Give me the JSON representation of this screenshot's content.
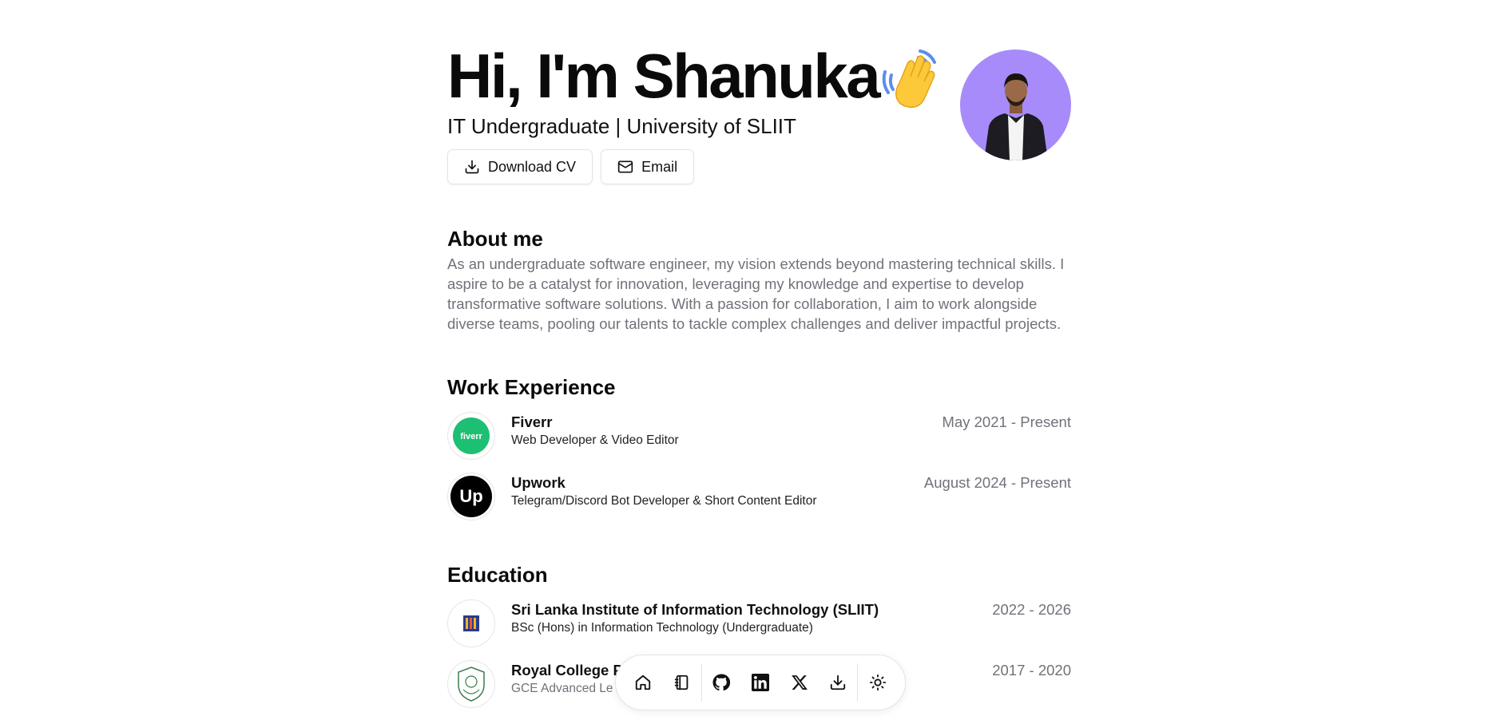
{
  "hero": {
    "title": "Hi, I'm Shanuka",
    "subtitle": "IT Undergraduate | University of SLIIT",
    "download_label": "Download CV",
    "email_label": "Email",
    "avatar_bg": "#a78bfa"
  },
  "about": {
    "heading": "About me",
    "text": "As an undergraduate software engineer, my vision extends beyond mastering technical skills. I aspire to be a catalyst for innovation, leveraging my knowledge and expertise to develop transformative software solutions. With a passion for collaboration, I aim to work alongside diverse teams, pooling our talents to tackle complex challenges and deliver impactful projects."
  },
  "work": {
    "heading": "Work Experience",
    "items": [
      {
        "company": "Fiverr",
        "role": "Web Developer & Video Editor",
        "dates": "May 2021 - Present",
        "logo_text": "fiverr",
        "logo_color": "#1dbf73"
      },
      {
        "company": "Upwork",
        "role": "Telegram/Discord Bot Developer & Short Content Editor",
        "dates": "August 2024 - Present",
        "logo_text": "Up",
        "logo_color": "#000000"
      }
    ]
  },
  "education": {
    "heading": "Education",
    "items": [
      {
        "school": "Sri Lanka Institute of Information Technology (SLIIT)",
        "degree": "BSc (Hons) in Information Technology (Undergraduate)",
        "dates": "2022 - 2026"
      },
      {
        "school": "Royal College P",
        "degree": "GCE Advanced Le",
        "dates": "2017 - 2020"
      }
    ]
  },
  "dock": {
    "items": [
      "home-icon",
      "notebook-icon",
      "github-icon",
      "linkedin-icon",
      "x-icon",
      "download-icon",
      "sun-icon"
    ]
  }
}
